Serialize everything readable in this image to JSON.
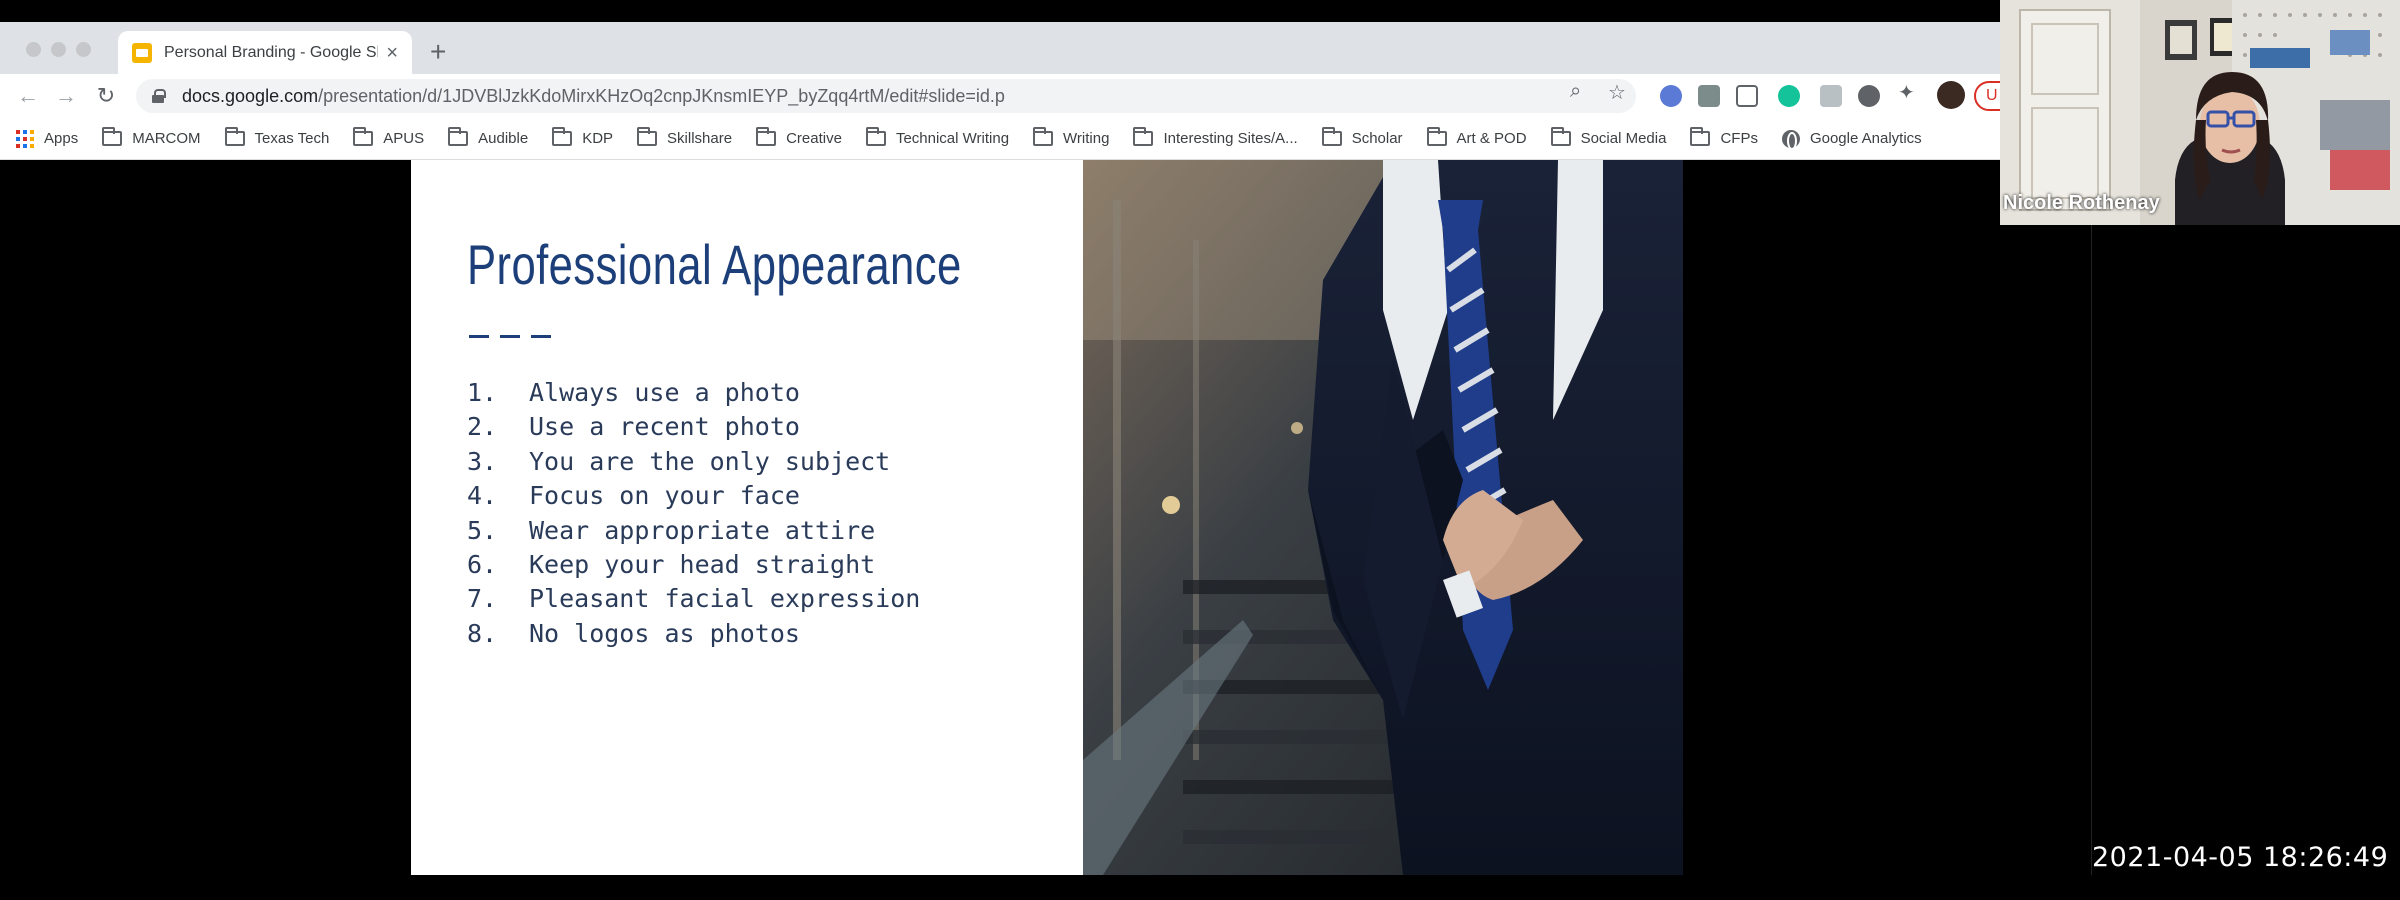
{
  "browser": {
    "tab": {
      "title": "Personal Branding - Google Sli"
    },
    "address": {
      "host": "docs.google.com",
      "path": "/presentation/d/1JDVBlJzkKdoMirxKHzOq2cnpJKnsmIEYP_byZqq4rtM/edit#slide=id.p"
    },
    "bookmarks": [
      {
        "label": "Apps",
        "icon": "apps-grid-icon"
      },
      {
        "label": "MARCOM",
        "icon": "folder-icon"
      },
      {
        "label": "Texas Tech",
        "icon": "folder-icon"
      },
      {
        "label": "APUS",
        "icon": "folder-icon"
      },
      {
        "label": "Audible",
        "icon": "folder-icon"
      },
      {
        "label": "KDP",
        "icon": "folder-icon"
      },
      {
        "label": "Skillshare",
        "icon": "folder-icon"
      },
      {
        "label": "Creative",
        "icon": "folder-icon"
      },
      {
        "label": "Technical Writing",
        "icon": "folder-icon"
      },
      {
        "label": "Writing",
        "icon": "folder-icon"
      },
      {
        "label": "Interesting Sites/A...",
        "icon": "folder-icon"
      },
      {
        "label": "Scholar",
        "icon": "folder-icon"
      },
      {
        "label": "Art & POD",
        "icon": "folder-icon"
      },
      {
        "label": "Social Media",
        "icon": "folder-icon"
      },
      {
        "label": "CFPs",
        "icon": "folder-icon"
      },
      {
        "label": "Google Analytics",
        "icon": "globe-icon"
      }
    ],
    "update_badge": "U"
  },
  "slide": {
    "title": "Professional Appearance",
    "items": [
      {
        "num": "1.",
        "text": "Always use a photo"
      },
      {
        "num": "2.",
        "text": "Use a recent photo"
      },
      {
        "num": "3.",
        "text": "You are the only subject"
      },
      {
        "num": "4.",
        "text": "Focus on your face"
      },
      {
        "num": "5.",
        "text": "Wear appropriate attire"
      },
      {
        "num": "6.",
        "text": "Keep your head straight"
      },
      {
        "num": "7.",
        "text": "Pleasant facial expression"
      },
      {
        "num": "8.",
        "text": "No logos as photos"
      }
    ],
    "accent_color": "#1c3f7a"
  },
  "webcam": {
    "name": "Nicole Rothenay"
  },
  "timestamp": "2021-04-05 18:26:49"
}
